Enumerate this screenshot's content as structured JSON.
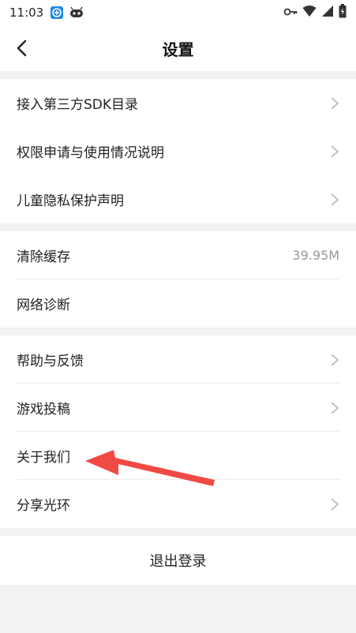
{
  "status_bar": {
    "time": "11:03",
    "left_icons": [
      "app-notification-icon",
      "robot-icon"
    ],
    "right_icons": [
      "key-icon",
      "wifi-icon",
      "signal-icon",
      "battery-icon"
    ]
  },
  "header": {
    "title": "设置",
    "back_icon": "chevron-left-icon"
  },
  "groups": {
    "group1": [
      {
        "label": "接入第三方SDK目录"
      },
      {
        "label": "权限申请与使用情况说明"
      },
      {
        "label": "儿童隐私保护声明"
      }
    ],
    "group2": [
      {
        "label": "清除缓存",
        "value": "39.95M"
      },
      {
        "label": "网络诊断"
      }
    ],
    "group3": [
      {
        "label": "帮助与反馈"
      },
      {
        "label": "游戏投稿"
      },
      {
        "label": "关于我们"
      },
      {
        "label": "分享光环"
      }
    ]
  },
  "logout": {
    "label": "退出登录"
  },
  "annotation": {
    "color": "#f04a44"
  }
}
